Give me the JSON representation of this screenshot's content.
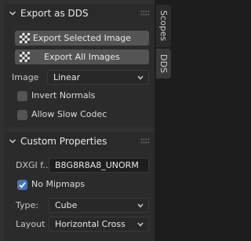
{
  "tabs": [
    {
      "label": "Scopes",
      "active": false
    },
    {
      "label": "DDS",
      "active": true
    }
  ],
  "export_panel": {
    "title": "Export as DDS",
    "export_selected_label": "Export Selected Image",
    "export_all_label": "Export All Images",
    "image_label": "Image",
    "image_value": "Linear",
    "invert_normals_label": "Invert Normals",
    "invert_normals_checked": false,
    "allow_slow_codec_label": "Allow Slow Codec",
    "allow_slow_codec_checked": false
  },
  "custom_panel": {
    "title": "Custom Properties",
    "dxgi_label": "DXGI f...",
    "dxgi_value": "B8G8R8A8_UNORM",
    "no_mipmaps_label": "No Mipmaps",
    "no_mipmaps_checked": true,
    "type_label": "Type:",
    "type_value": "Cube",
    "layout_label": "Layout",
    "layout_value": "Horizontal Cross"
  },
  "colors": {
    "accent": "#4772b3",
    "button": "#545454",
    "panel": "#2b2b2b",
    "background": "#303030"
  }
}
